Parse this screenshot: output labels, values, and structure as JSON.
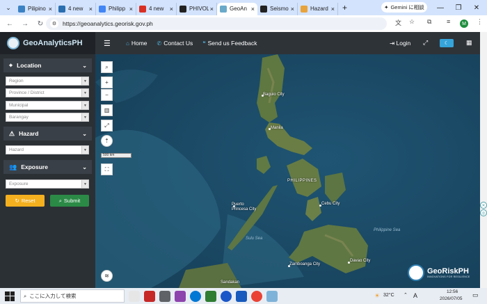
{
  "browser": {
    "tabs": [
      {
        "label": "Pilipino",
        "color": "#3b82c4",
        "active": false
      },
      {
        "label": "4 new",
        "color": "#2a6fb0",
        "active": false
      },
      {
        "label": "Philipp",
        "color": "#4285f4",
        "active": false
      },
      {
        "label": "4 new",
        "color": "#d93025",
        "active": false
      },
      {
        "label": "PHIVOL",
        "color": "#222222",
        "active": false
      },
      {
        "label": "GeoAn",
        "color": "#6aa9c9",
        "active": true
      },
      {
        "label": "Seismo",
        "color": "#222222",
        "active": false
      },
      {
        "label": "Hazard",
        "color": "#e8a33d",
        "active": false
      }
    ],
    "new_tab": "+",
    "gemini_button": "Gemini に相談",
    "url": "https://geoanalytics.georisk.gov.ph",
    "profile_initial": "M"
  },
  "header": {
    "brand": "GeoAnalyticsPH",
    "nav": [
      {
        "label": "Home",
        "icon": "home-icon"
      },
      {
        "label": "Contact Us",
        "icon": "phone-icon"
      },
      {
        "label": "Send us Feedback",
        "icon": "comments-icon"
      }
    ],
    "login": "Login"
  },
  "sidebar": {
    "location": {
      "title": "Location",
      "fields": [
        "Region",
        "Province / District",
        "Municipal",
        "Barangay"
      ]
    },
    "hazard": {
      "title": "Hazard",
      "fields": [
        "Hazard"
      ]
    },
    "exposure": {
      "title": "Exposure",
      "fields": [
        "Exposure"
      ]
    },
    "reset_label": "Reset",
    "submit_label": "Submit"
  },
  "map": {
    "scale": "500 km",
    "places": [
      {
        "name": "Baguio City",
        "type": "city"
      },
      {
        "name": "Manila",
        "type": "city"
      },
      {
        "name": "PHILIPPINES",
        "type": "country"
      },
      {
        "name": "Puerto Princesa City",
        "type": "city"
      },
      {
        "name": "Cebu City",
        "type": "city"
      },
      {
        "name": "Sulu Sea",
        "type": "water"
      },
      {
        "name": "Philippine Sea",
        "type": "water"
      },
      {
        "name": "Zamboanga City",
        "type": "city"
      },
      {
        "name": "Davao City",
        "type": "city"
      },
      {
        "name": "Sandakan",
        "type": "city"
      }
    ],
    "logo_text": "GeoRiskPH",
    "logo_sub": "INNOVATIONS FOR RESILIENCE"
  },
  "taskbar": {
    "search_placeholder": "ここに入力して検索",
    "temperature": "32°C",
    "ime": "A",
    "time": "12:56",
    "date": "2026/07/05"
  }
}
